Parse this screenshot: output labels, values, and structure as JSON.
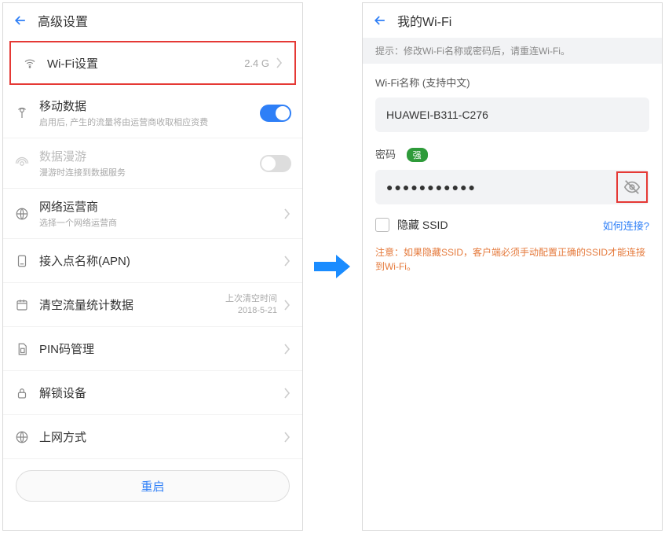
{
  "left": {
    "title": "高级设置",
    "rows": {
      "wifi": {
        "label": "Wi-Fi设置",
        "value": "2.4 G"
      },
      "mobile_data": {
        "label": "移动数据",
        "sub": "启用后, 产生的流量将由运营商收取相应资费"
      },
      "roaming": {
        "label": "数据漫游",
        "sub": "漫游时连接到数据服务"
      },
      "carrier": {
        "label": "网络运营商",
        "sub": "选择一个网络运营商"
      },
      "apn": {
        "label": "接入点名称(APN)"
      },
      "traffic": {
        "label": "清空流量统计数据",
        "value_top": "上次清空时间",
        "value_bottom": "2018-5-21"
      },
      "pin": {
        "label": "PIN码管理"
      },
      "unlock": {
        "label": "解锁设备"
      },
      "net_mode": {
        "label": "上网方式"
      }
    },
    "reboot": "重启"
  },
  "right": {
    "title": "我的Wi-Fi",
    "hint": "提示：修改Wi-Fi名称或密码后，请重连Wi-Fi。",
    "name_label": "Wi-Fi名称 (支持中文)",
    "name_value": "HUAWEI-B311-C276",
    "pwd_label": "密码",
    "strength": "强",
    "pwd_value": "●●●●●●●●●●●",
    "hide_ssid": "隐藏 SSID",
    "how_connect": "如何连接?",
    "warn": "注意：如果隐藏SSID，客户端必须手动配置正确的SSID才能连接到Wi-Fi。"
  }
}
